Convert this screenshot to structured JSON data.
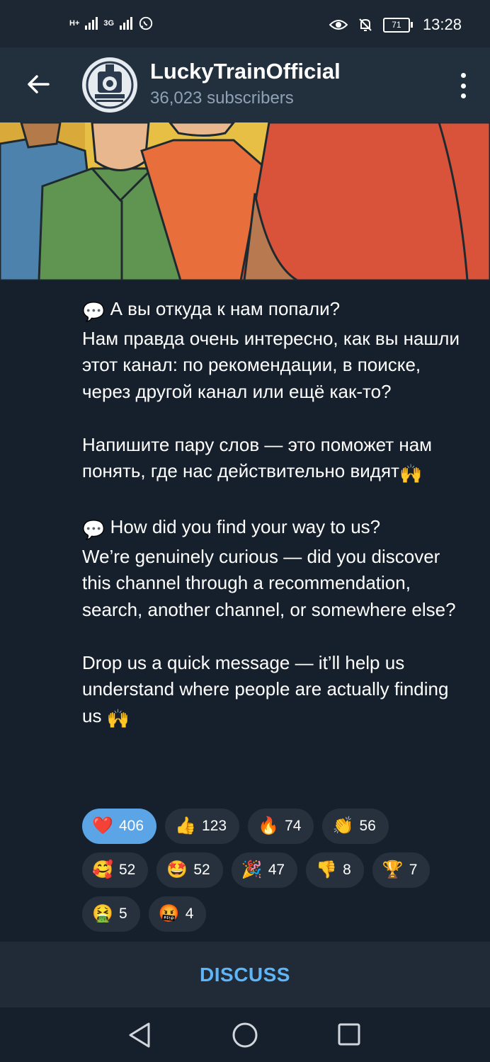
{
  "status_bar": {
    "left_indicators": [
      "H+",
      "3G"
    ],
    "time": "13:28",
    "battery": "71",
    "icons": [
      "signal-icon",
      "whatsapp-icon",
      "eye-icon",
      "bell-off-icon",
      "battery-icon"
    ]
  },
  "header": {
    "channel_name": "LuckyTrainOfficial",
    "subscribers": "36,023 subscribers",
    "icons": [
      "back-arrow-icon",
      "channel-avatar",
      "more-vertical-icon"
    ]
  },
  "message": {
    "ru_q": "А вы откуда к нам попали?",
    "ru_body": "Нам правда очень интересно, как вы нашли этот канал: по рекомендации, в поиске, через другой канал или ещё как-то?",
    "ru_cta": "Напишите пару слов — это поможет нам понять, где нас действительно видят",
    "en_q": "How did you find your way to us?",
    "en_body": "We’re genuinely curious — did you discover this channel through a recommendation, search, another channel, or somewhere else?",
    "en_cta": "Drop us a quick message — it’ll help us understand where people are actually finding us",
    "emoji_speech": "💬",
    "emoji_hands": "🙌"
  },
  "reactions": [
    {
      "emoji": "❤️",
      "count": "406",
      "active": true
    },
    {
      "emoji": "👍",
      "count": "123"
    },
    {
      "emoji": "🔥",
      "count": "74"
    },
    {
      "emoji": "👏",
      "count": "56"
    },
    {
      "emoji": "🥰",
      "count": "52"
    },
    {
      "emoji": "🤩",
      "count": "52"
    },
    {
      "emoji": "🎉",
      "count": "47"
    },
    {
      "emoji": "👎",
      "count": "8"
    },
    {
      "emoji": "🏆",
      "count": "7"
    },
    {
      "emoji": "🤮",
      "count": "5"
    },
    {
      "emoji": "🤬",
      "count": "4"
    }
  ],
  "discuss_label": "DISCUSS",
  "nav": [
    "back-triangle-icon",
    "home-circle-icon",
    "recents-square-icon"
  ],
  "colors": {
    "accent": "#5eb5f7",
    "active_reaction": "#5ba4e5",
    "background": "#16202c"
  }
}
